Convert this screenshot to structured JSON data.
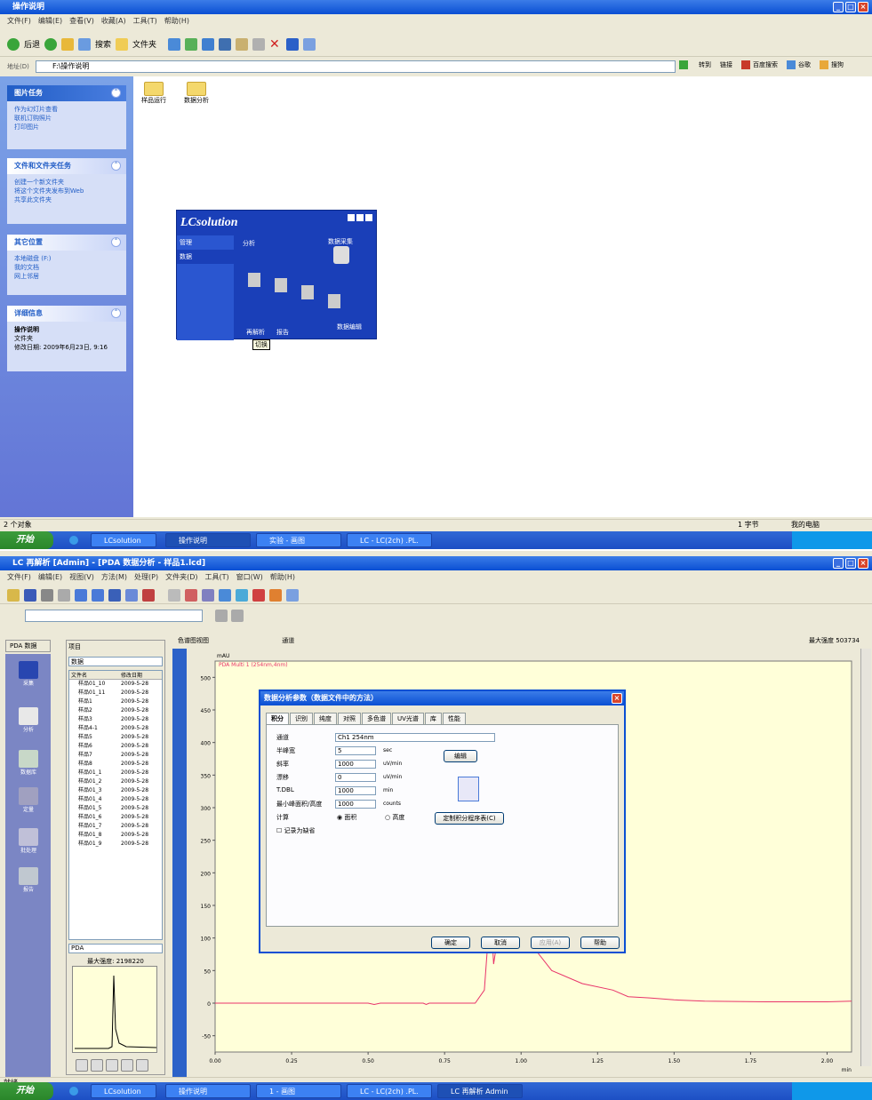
{
  "top_window": {
    "title": "操作说明",
    "menus": [
      "文件(F)",
      "编辑(E)",
      "查看(V)",
      "收藏(A)",
      "工具(T)",
      "帮助(H)"
    ],
    "toolbar": {
      "back": "后退",
      "search": "搜索",
      "folders": "文件夹"
    },
    "address_label": "地址(D)",
    "address_value": "F:\\操作说明",
    "address_right": [
      "转到",
      "链接",
      "百度搜索",
      "谷歌",
      "搜狗"
    ],
    "tasks_panel": {
      "title": "图片任务",
      "items": [
        "作为幻灯片查看",
        "联机订购照片",
        "打印图片"
      ]
    },
    "file_tasks_panel": {
      "title": "文件和文件夹任务",
      "items": [
        "创建一个新文件夹",
        "将这个文件夹发布到Web",
        "共享此文件夹"
      ]
    },
    "other_places_panel": {
      "title": "其它位置",
      "items": [
        "本地磁盘 (F:)",
        "我的文档",
        "网上邻居"
      ]
    },
    "details_panel": {
      "title": "详细信息",
      "name": "操作说明",
      "type": "文件夹",
      "modified": "修改日期: 2009年6月23日, 9:16"
    },
    "folders": [
      "样品运行",
      "数据分析"
    ],
    "lc_splash": {
      "brand": "LCsolution",
      "menu_items": [
        "管理",
        "数据"
      ],
      "labels": [
        "分析",
        "数据采集",
        "再解析",
        "报告",
        "数据编辑"
      ],
      "button": "切换"
    },
    "status": {
      "left": "2 个对象",
      "mid": "1 字节",
      "right": "我的电脑"
    }
  },
  "top_taskbar": {
    "start": "开始",
    "tasks": [
      "LCsolution",
      "操作说明",
      "实验 - 画图",
      "LC - LC(2ch) .PL."
    ],
    "clock": ""
  },
  "bottom_window": {
    "title": "LC 再解析 [Admin] - [PDA 数据分析 - 样品1.lcd]",
    "menus": [
      "文件(F)",
      "编辑(E)",
      "视图(V)",
      "方法(M)",
      "处理(P)",
      "文件夹(D)",
      "工具(T)",
      "窗口(W)",
      "帮助(H)"
    ],
    "sidebar_tabs": [
      "PDA 数据"
    ],
    "sidebar_items": [
      "采集",
      "分析",
      "数据库",
      "定量",
      "批处理",
      "报告"
    ],
    "file_panel": {
      "title": "项目",
      "folder": "数据",
      "col_name": "文件名",
      "col_date": "修改日期",
      "files": [
        {
          "name": "样品01_10",
          "date": "2009-5-28"
        },
        {
          "name": "样品01_11",
          "date": "2009-5-28"
        },
        {
          "name": "样品1",
          "date": "2009-5-28"
        },
        {
          "name": "样品2",
          "date": "2009-5-28"
        },
        {
          "name": "样品3",
          "date": "2009-5-28"
        },
        {
          "name": "样品4-1",
          "date": "2009-5-28"
        },
        {
          "name": "样品5",
          "date": "2009-5-28"
        },
        {
          "name": "样品6",
          "date": "2009-5-28"
        },
        {
          "name": "样品7",
          "date": "2009-5-28"
        },
        {
          "name": "样品8",
          "date": "2009-5-28"
        },
        {
          "name": "样品01_1",
          "date": "2009-5-28"
        },
        {
          "name": "样品01_2",
          "date": "2009-5-28"
        },
        {
          "name": "样品01_3",
          "date": "2009-5-28"
        },
        {
          "name": "样品01_4",
          "date": "2009-5-28"
        },
        {
          "name": "样品01_5",
          "date": "2009-5-28"
        },
        {
          "name": "样品01_6",
          "date": "2009-5-28"
        },
        {
          "name": "样品01_7",
          "date": "2009-5-28"
        },
        {
          "name": "样品01_8",
          "date": "2009-5-28"
        },
        {
          "name": "样品01_9",
          "date": "2009-5-28"
        }
      ],
      "preview_select": "PDA",
      "preview_label": "最大强度: 2198220"
    },
    "chart_header": {
      "label": "色谱图视图",
      "channel": "通道",
      "max_label": "最大强度 503734"
    },
    "chart_data": {
      "type": "line",
      "ylabel": "mAU",
      "series": [
        {
          "name": "PDA Multi 1 (254nm,4nm)",
          "color": "#e8336a"
        }
      ],
      "xticks": [
        "0.00",
        "0.25",
        "0.50",
        "0.75",
        "1.00",
        "1.25",
        "1.50",
        "1.75",
        "2.00"
      ],
      "yticks": [
        "500",
        "450",
        "400",
        "350",
        "300",
        "250",
        "200",
        "150",
        "100",
        "50",
        "0",
        "-50"
      ],
      "xlim": [
        0.0,
        2.08
      ],
      "ylim": [
        -75,
        525
      ],
      "xlabel": "min"
    },
    "dialog": {
      "title": "数据分析参数（数据文件中的方法）",
      "tabs": [
        "积分",
        "识别",
        "纯度",
        "对照",
        "多色谱",
        "UV光谱",
        "库",
        "性能"
      ],
      "fields": [
        {
          "label": "通道",
          "value": "Ch1 254nm"
        },
        {
          "label": "半峰宽",
          "value": "5",
          "unit": "sec"
        },
        {
          "label": "斜率",
          "value": "1000",
          "unit": "uV/min"
        },
        {
          "label": "漂移",
          "value": "0",
          "unit": "uV/min"
        },
        {
          "label": "T.DBL",
          "value": "1000",
          "unit": "min"
        },
        {
          "label": "最小峰面积/高度",
          "value": "1000",
          "unit": "counts"
        }
      ],
      "calc_label": "计算",
      "radio_area": "面积",
      "radio_height": "高度",
      "checkbox": "记录为缺省",
      "btn_edit": "编辑",
      "btn_program": "定制积分程序表(C)",
      "buttons": [
        "确定",
        "取消",
        "应用(A)",
        "帮助"
      ]
    },
    "status_left": "就绪"
  },
  "bottom_taskbar": {
    "start": "开始",
    "tasks": [
      "LCsolution",
      "操作说明",
      "1 - 画图",
      "LC - LC(2ch) .PL.",
      "LC 再解析 Admin"
    ]
  }
}
